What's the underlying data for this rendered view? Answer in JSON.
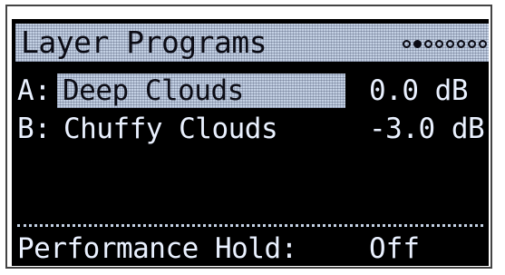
{
  "header": {
    "title": "Layer Programs",
    "pages_total": 8,
    "active_page": 2
  },
  "layers": [
    {
      "slot": "A:",
      "program": "Deep Clouds",
      "volume": "0.0 dB",
      "selected": true
    },
    {
      "slot": "B:",
      "program": "Chuffy Clouds",
      "volume": "-3.0 dB",
      "selected": false
    }
  ],
  "footer": {
    "label": "Performance Hold:",
    "value": "Off"
  },
  "colors": {
    "screen_background": "#000000",
    "highlight": "#c3d0e3",
    "text": "#eaf1ff"
  }
}
